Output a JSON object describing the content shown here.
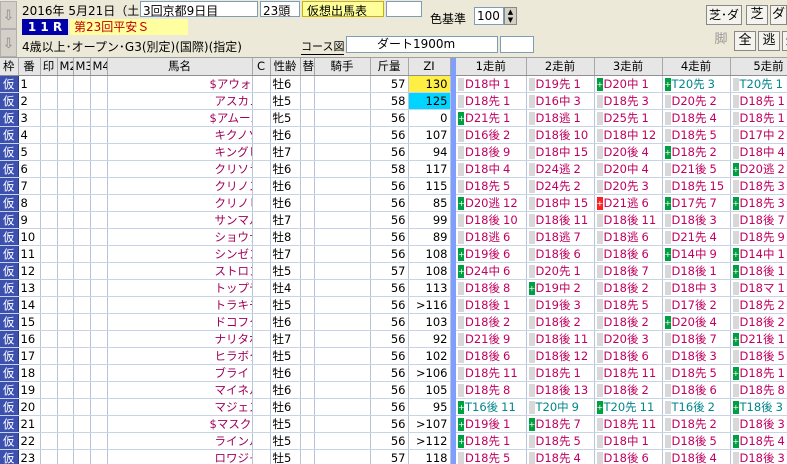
{
  "header": {
    "date": "2016年 5月21日（土）",
    "meet": "3回京都9日目",
    "heads": "23頭",
    "forecast_tab": "仮想出馬表",
    "race_no": "1 1 R",
    "race_name": "第23回平安Ｓ",
    "conditions": "4歳以上･オープン･G3(別定)(国際)(指定)",
    "course_btn": "コース図",
    "course": "ダート1900m",
    "color_label": "色基準",
    "color_value": "100",
    "btn_turf_dirt": "芝･ダ",
    "btn_turf": "芝",
    "btn_dirt": "ダ",
    "btn_leg": "脚",
    "btn_all": "全",
    "btn_nige": "逃",
    "btn_sen": "先",
    "nav_up": "⇩",
    "nav_down": "⇩"
  },
  "columns": {
    "waku": "枠",
    "ban": "番",
    "in": "印",
    "m2": "M2",
    "m3": "M3",
    "m4": "M4",
    "name": "馬名",
    "c": "C",
    "sex": "性齢",
    "alt": "替",
    "jockey": "騎手",
    "kin": "斤量",
    "zi": "ZI",
    "p1": "1走前",
    "p2": "2走前",
    "p3": "3走前",
    "p4": "4走前",
    "p5": "5走前"
  },
  "rows": [
    {
      "w": "仮",
      "no": "1",
      "name": "$アウォーディー",
      "sex": "牡6",
      "kin": "57",
      "zi": "130",
      "zic": "zi1",
      "p": [
        [
          "",
          "D18中",
          "1"
        ],
        [
          "",
          "D19先",
          "1"
        ],
        [
          "g",
          "D20中",
          "1"
        ],
        [
          "g",
          "T20先",
          "3",
          "t"
        ],
        [
          "",
          "T20先",
          "1",
          "t"
        ]
      ]
    },
    {
      "w": "仮",
      "no": "2",
      "name": "アスカノロマン",
      "sex": "牡5",
      "kin": "58",
      "zi": "125",
      "zic": "zi2",
      "p": [
        [
          "",
          "D18先",
          "1"
        ],
        [
          "",
          "D16中",
          "3"
        ],
        [
          "",
          "D18先",
          "3"
        ],
        [
          "",
          "D20先",
          "2"
        ],
        [
          "",
          "D18先",
          "1"
        ]
      ]
    },
    {
      "w": "仮",
      "no": "3",
      "name": "$アムールブリエ",
      "sex": "牝5",
      "kin": "56",
      "zi": "0",
      "zic": "",
      "p": [
        [
          "g",
          "D21先",
          "1"
        ],
        [
          "",
          "D18逃",
          "1"
        ],
        [
          "",
          "D25先",
          "1"
        ],
        [
          "",
          "D18先",
          "4"
        ],
        [
          "",
          "D18先",
          "1"
        ]
      ]
    },
    {
      "w": "仮",
      "no": "4",
      "name": "キクノソル",
      "sex": "牡6",
      "kin": "56",
      "zi": "107",
      "zic": "",
      "p": [
        [
          "",
          "D16後",
          "2"
        ],
        [
          "",
          "D18後",
          "10"
        ],
        [
          "",
          "D18中",
          "12"
        ],
        [
          "",
          "D18先",
          "5"
        ],
        [
          "",
          "D17中",
          "2"
        ]
      ]
    },
    {
      "w": "仮",
      "no": "5",
      "name": "キングヒーロー",
      "sex": "牡7",
      "kin": "56",
      "zi": "94",
      "zic": "",
      "p": [
        [
          "",
          "D18後",
          "9"
        ],
        [
          "",
          "D18中",
          "15"
        ],
        [
          "",
          "D20後",
          "4"
        ],
        [
          "g",
          "D18先",
          "2"
        ],
        [
          "",
          "D18中",
          "4"
        ]
      ]
    },
    {
      "w": "仮",
      "no": "6",
      "name": "クリソライト",
      "sex": "牡6",
      "kin": "58",
      "zi": "117",
      "zic": "",
      "p": [
        [
          "",
          "D18中",
          "4"
        ],
        [
          "",
          "D24逃",
          "2"
        ],
        [
          "",
          "D20中",
          "4"
        ],
        [
          "",
          "D21後",
          "5"
        ],
        [
          "g",
          "D20逃",
          "2"
        ]
      ]
    },
    {
      "w": "仮",
      "no": "7",
      "name": "クリノスターオー",
      "sex": "牡6",
      "kin": "56",
      "zi": "115",
      "zic": "",
      "p": [
        [
          "",
          "D18先",
          "5"
        ],
        [
          "",
          "D24先",
          "2"
        ],
        [
          "",
          "D20先",
          "3"
        ],
        [
          "",
          "D18先",
          "15"
        ],
        [
          "",
          "D18先",
          "3"
        ]
      ]
    },
    {
      "w": "仮",
      "no": "8",
      "name": "クリノヒマラヤオー",
      "sex": "牡6",
      "kin": "56",
      "zi": "85",
      "zic": "",
      "p": [
        [
          "g",
          "D20逃",
          "12"
        ],
        [
          "",
          "D18中",
          "15"
        ],
        [
          "r",
          "D21逃",
          "6"
        ],
        [
          "g",
          "D17先",
          "7"
        ],
        [
          "g",
          "D18先",
          "3"
        ]
      ]
    },
    {
      "w": "仮",
      "no": "9",
      "name": "サンマルデューク",
      "sex": "牡7",
      "kin": "56",
      "zi": "99",
      "zic": "",
      "p": [
        [
          "",
          "D18後",
          "10"
        ],
        [
          "",
          "D18後",
          "11"
        ],
        [
          "",
          "D18後",
          "11"
        ],
        [
          "",
          "D18後",
          "3"
        ],
        [
          "",
          "D18後",
          "7"
        ]
      ]
    },
    {
      "w": "仮",
      "no": "10",
      "name": "ショウナンアポロン",
      "sex": "牡8",
      "kin": "56",
      "zi": "89",
      "zic": "",
      "p": [
        [
          "",
          "D18逃",
          "6"
        ],
        [
          "",
          "D18逃",
          "7"
        ],
        [
          "",
          "D18逃",
          "6"
        ],
        [
          "",
          "D21先",
          "4"
        ],
        [
          "",
          "D18先",
          "9"
        ]
      ]
    },
    {
      "w": "仮",
      "no": "11",
      "name": "シンゼンレンジャー",
      "sex": "牡7",
      "kin": "56",
      "zi": "108",
      "zic": "",
      "p": [
        [
          "g",
          "D19後",
          "6"
        ],
        [
          "",
          "D18後",
          "6"
        ],
        [
          "",
          "D18後",
          "6"
        ],
        [
          "g",
          "D14中",
          "9"
        ],
        [
          "g",
          "D14中",
          "1"
        ]
      ]
    },
    {
      "w": "仮",
      "no": "12",
      "name": "ストロングサウザー",
      "sex": "牡5",
      "kin": "57",
      "zi": "108",
      "zic": "",
      "p": [
        [
          "g",
          "D24中",
          "6"
        ],
        [
          "",
          "D20先",
          "1"
        ],
        [
          "",
          "D18後",
          "7"
        ],
        [
          "",
          "D18後",
          "1"
        ],
        [
          "g",
          "D18後",
          "1"
        ]
      ]
    },
    {
      "w": "仮",
      "no": "13",
      "name": "トップディーヴォ",
      "sex": "牡4",
      "kin": "56",
      "zi": "113",
      "zic": "",
      "p": [
        [
          "",
          "D18後",
          "8"
        ],
        [
          "g",
          "D19中",
          "2"
        ],
        [
          "",
          "D18後",
          "2"
        ],
        [
          "",
          "D18中",
          "3"
        ],
        [
          "",
          "D18マ",
          "1"
        ]
      ]
    },
    {
      "w": "仮",
      "no": "14",
      "name": "トラキチシャチョウ",
      "sex": "牡5",
      "kin": "56",
      "zi": ">116",
      "zic": "",
      "p": [
        [
          "",
          "D18後",
          "1"
        ],
        [
          "",
          "D19後",
          "3"
        ],
        [
          "",
          "D18先",
          "5"
        ],
        [
          "",
          "D17後",
          "2"
        ],
        [
          "",
          "D18先",
          "2"
        ]
      ]
    },
    {
      "w": "仮",
      "no": "15",
      "name": "ドコフクカゼ",
      "sex": "牡6",
      "kin": "56",
      "zi": "103",
      "zic": "",
      "p": [
        [
          "",
          "D18後",
          "2"
        ],
        [
          "",
          "D18後",
          "2"
        ],
        [
          "",
          "D18後",
          "2"
        ],
        [
          "g",
          "D20後",
          "4"
        ],
        [
          "",
          "D18後",
          "2"
        ]
      ]
    },
    {
      "w": "仮",
      "no": "16",
      "name": "ナリタポセイドン",
      "sex": "牡7",
      "kin": "56",
      "zi": "92",
      "zic": "",
      "p": [
        [
          "",
          "D21後",
          "9"
        ],
        [
          "",
          "D18後",
          "11"
        ],
        [
          "",
          "D20後",
          "3"
        ],
        [
          "",
          "D18後",
          "7"
        ],
        [
          "g",
          "D21後",
          "1"
        ]
      ]
    },
    {
      "w": "仮",
      "no": "17",
      "name": "ヒラボクプリンス",
      "sex": "牡5",
      "kin": "56",
      "zi": "102",
      "zic": "",
      "p": [
        [
          "",
          "D18後",
          "6"
        ],
        [
          "",
          "D18後",
          "12"
        ],
        [
          "",
          "D18後",
          "6"
        ],
        [
          "",
          "D18後",
          "3"
        ],
        [
          "s",
          "D18後",
          "5"
        ]
      ]
    },
    {
      "w": "仮",
      "no": "18",
      "name": "ブライトアイディア",
      "sex": "牡6",
      "kin": "56",
      "zi": ">106",
      "zic": "",
      "p": [
        [
          "",
          "D18先",
          "11"
        ],
        [
          "",
          "D18先",
          "1"
        ],
        [
          "",
          "D18先",
          "11"
        ],
        [
          "",
          "D18先",
          "5"
        ],
        [
          "g",
          "D18先",
          "1"
        ]
      ]
    },
    {
      "w": "仮",
      "no": "19",
      "name": "マイネルクロップ",
      "sex": "牡6",
      "kin": "56",
      "zi": "105",
      "zic": "",
      "p": [
        [
          "",
          "D18先",
          "8"
        ],
        [
          "",
          "D18後",
          "13"
        ],
        [
          "",
          "D18後",
          "2"
        ],
        [
          "",
          "D18後",
          "6"
        ],
        [
          "",
          "D18先",
          "8"
        ]
      ]
    },
    {
      "w": "仮",
      "no": "20",
      "name": "マジェスティハーツ",
      "sex": "牡6",
      "kin": "56",
      "zi": "95",
      "zic": "",
      "p": [
        [
          "g",
          "T16後",
          "11",
          "t"
        ],
        [
          "",
          "T20中",
          "9",
          "t"
        ],
        [
          "g",
          "T20先",
          "11",
          "t"
        ],
        [
          "",
          "T16後",
          "2",
          "t"
        ],
        [
          "g",
          "T18後",
          "3",
          "t"
        ]
      ]
    },
    {
      "w": "仮",
      "no": "21",
      "name": "$マスクゾロ",
      "sex": "牡5",
      "kin": "56",
      "zi": ">107",
      "zic": "",
      "p": [
        [
          "g",
          "D19後",
          "1"
        ],
        [
          "g",
          "D18先",
          "7"
        ],
        [
          "",
          "D18先",
          "11"
        ],
        [
          "",
          "D18先",
          "2"
        ],
        [
          "",
          "D18後",
          "3"
        ]
      ]
    },
    {
      "w": "仮",
      "no": "22",
      "name": "ラインルーフ",
      "sex": "牡5",
      "kin": "56",
      "zi": ">112",
      "zic": "",
      "p": [
        [
          "g",
          "D18先",
          "1"
        ],
        [
          "",
          "D18先",
          "5"
        ],
        [
          "",
          "D18中",
          "1"
        ],
        [
          "",
          "D18後",
          "5"
        ],
        [
          "g",
          "D18先",
          "4"
        ]
      ]
    },
    {
      "w": "仮",
      "no": "23",
      "name": "ロワジャルダン",
      "sex": "牡5",
      "kin": "57",
      "zi": "118",
      "zic": "",
      "p": [
        [
          "",
          "D18先",
          "5"
        ],
        [
          "",
          "D18先",
          "4"
        ],
        [
          "",
          "D18後",
          "6"
        ],
        [
          "",
          "D18後",
          "4"
        ],
        [
          "",
          "D18後",
          "3"
        ]
      ]
    }
  ],
  "colors": {
    "waku": "#3c50b0",
    "name": "#a0005a",
    "turf": "#00868b",
    "zi_top": "#ffee44",
    "zi_second": "#00d4ff"
  }
}
